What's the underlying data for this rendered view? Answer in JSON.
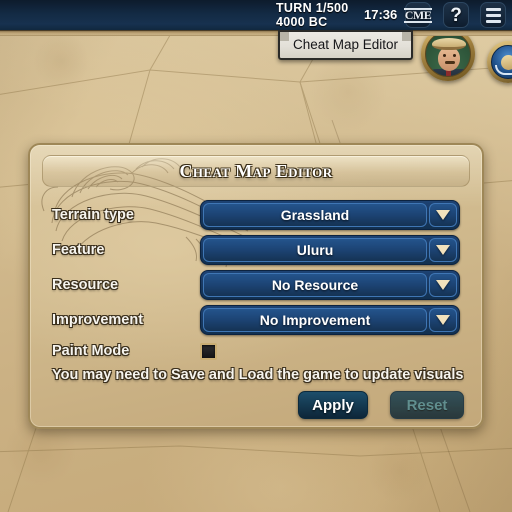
{
  "hud": {
    "turn": "TURN 1/500",
    "era_year": "4000 BC",
    "clock": "17:36",
    "cme_button_label": "CME",
    "help_button_label": "?",
    "menu_icon": "hamburger-menu-icon",
    "portrait_name": "leader-portrait",
    "emblem_name": "civ-emblem"
  },
  "tooltip": {
    "text": "Cheat Map Editor"
  },
  "dialog": {
    "title": "Cheat Map Editor",
    "rows": [
      {
        "label": "Terrain type",
        "value": "Grassland",
        "name": "terrain-type"
      },
      {
        "label": "Feature",
        "value": "Uluru",
        "name": "feature"
      },
      {
        "label": "Resource",
        "value": "No Resource",
        "name": "resource"
      },
      {
        "label": "Improvement",
        "value": "No Improvement",
        "name": "improvement"
      }
    ],
    "paint_mode": {
      "label": "Paint Mode",
      "checked": false
    },
    "note": "You may need to Save and Load the game to update visuals",
    "buttons": {
      "apply": "Apply",
      "reset": "Reset"
    }
  },
  "colors": {
    "topbar": "#132a44",
    "parchment": "#cbb184",
    "dropdown_blue": "#1c4373",
    "dropdown_border": "#3f76b4",
    "arrow_cream": "#f2e2bc",
    "apply_text": "#ffffff",
    "reset_text_disabled": "#4e8a92",
    "tooltip_bg": "#e3e0d8"
  }
}
